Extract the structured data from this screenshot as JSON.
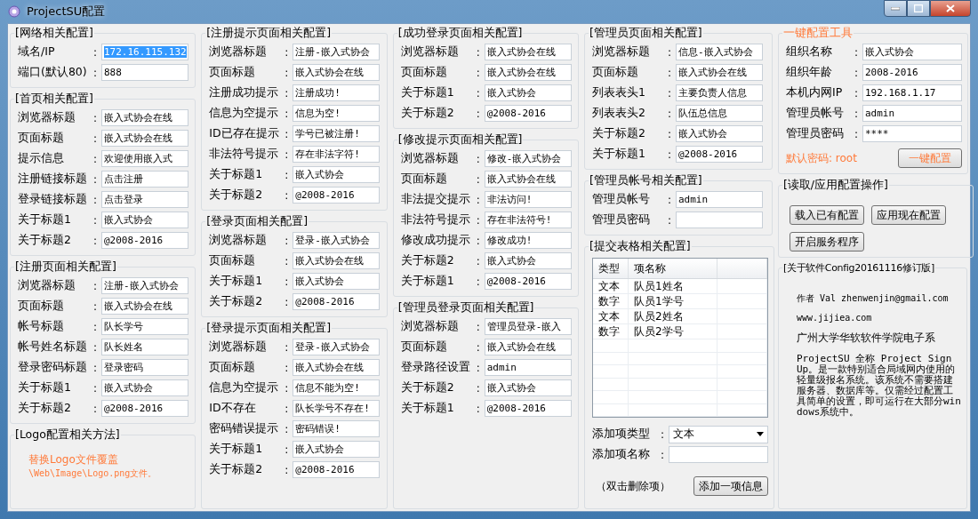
{
  "window": {
    "title": "ProjectSU配置"
  },
  "columns": [
    {
      "groups": [
        {
          "kind": "form",
          "title": "[网络相关配置]",
          "rows": [
            {
              "label": "域名/IP",
              "colon": ":",
              "value": "172.16.115.132",
              "selected": true
            },
            {
              "label": "端口(默认80)",
              "colon": ":",
              "value": "888",
              "selected": false
            }
          ]
        },
        {
          "kind": "form",
          "title": "[首页相关配置]",
          "rows": [
            {
              "label": "浏览器标题",
              "colon": ":",
              "value": "嵌入式协会在线"
            },
            {
              "label": "页面标题",
              "colon": ":",
              "value": "嵌入式协会在线"
            },
            {
              "label": "提示信息",
              "colon": ":",
              "value": "欢迎使用嵌入式"
            },
            {
              "label": "注册链接标题",
              "colon": ":",
              "value": "点击注册"
            },
            {
              "label": "登录链接标题",
              "colon": ":",
              "value": "点击登录"
            },
            {
              "label": "关于标题1",
              "colon": ":",
              "value": "嵌入式协会"
            },
            {
              "label": "关于标题2",
              "colon": ":",
              "value": "@2008-2016"
            }
          ]
        },
        {
          "kind": "form",
          "title": "[注册页面相关配置]",
          "rows": [
            {
              "label": "浏览器标题",
              "colon": ":",
              "value": "注册-嵌入式协会"
            },
            {
              "label": "页面标题",
              "colon": ":",
              "value": "嵌入式协会在线"
            },
            {
              "label": "帐号标题",
              "colon": ":",
              "value": "队长学号"
            },
            {
              "label": "帐号姓名标题",
              "colon": ":",
              "value": "队长姓名"
            },
            {
              "label": "登录密码标题",
              "colon": ":",
              "value": "登录密码"
            },
            {
              "label": "关于标题1",
              "colon": ":",
              "value": "嵌入式协会"
            },
            {
              "label": "关于标题2",
              "colon": ":",
              "value": "@2008-2016"
            }
          ]
        },
        {
          "kind": "note",
          "title": "[Logo配置相关方法]",
          "lines": [
            "替换Logo文件覆盖",
            "\\Web\\Image\\Logo.png文件。"
          ]
        }
      ]
    },
    {
      "groups": [
        {
          "kind": "form",
          "title": "[注册提示页面相关配置]",
          "rows": [
            {
              "label": "浏览器标题",
              "colon": ":",
              "value": "注册-嵌入式协会"
            },
            {
              "label": "页面标题",
              "colon": ":",
              "value": "嵌入式协会在线"
            },
            {
              "label": "注册成功提示",
              "colon": ":",
              "value": "注册成功!"
            },
            {
              "label": "信息为空提示",
              "colon": ":",
              "value": "信息为空!"
            },
            {
              "label": "ID已存在提示",
              "colon": ":",
              "value": "学号已被注册!"
            },
            {
              "label": "非法符号提示",
              "colon": ":",
              "value": "存在非法字符!"
            },
            {
              "label": "关于标题1",
              "colon": ":",
              "value": "嵌入式协会"
            },
            {
              "label": "关于标题2",
              "colon": ":",
              "value": "@2008-2016"
            }
          ]
        },
        {
          "kind": "form",
          "title": "[登录页面相关配置]",
          "rows": [
            {
              "label": "浏览器标题",
              "colon": ":",
              "value": "登录-嵌入式协会"
            },
            {
              "label": "页面标题",
              "colon": ":",
              "value": "嵌入式协会在线"
            },
            {
              "label": "关于标题1",
              "colon": ":",
              "value": "嵌入式协会"
            },
            {
              "label": "关于标题2",
              "colon": ":",
              "value": "@2008-2016"
            }
          ]
        },
        {
          "kind": "form",
          "title": "[登录提示页面相关配置]",
          "rows": [
            {
              "label": "浏览器标题",
              "colon": ":",
              "value": "登录-嵌入式协会"
            },
            {
              "label": "页面标题",
              "colon": ":",
              "value": "嵌入式协会在线"
            },
            {
              "label": "信息为空提示",
              "colon": ":",
              "value": "信息不能为空!"
            },
            {
              "label": "ID不存在",
              "colon": ":",
              "value": "队长学号不存在!"
            },
            {
              "label": "密码错误提示",
              "colon": ":",
              "value": "密码错误!"
            },
            {
              "label": "关于标题1",
              "colon": ":",
              "value": "嵌入式协会"
            },
            {
              "label": "关于标题2",
              "colon": ":",
              "value": "@2008-2016"
            }
          ]
        }
      ]
    },
    {
      "groups": [
        {
          "kind": "form",
          "title": "[成功登录页面相关配置]",
          "rows": [
            {
              "label": "浏览器标题",
              "colon": ":",
              "value": "嵌入式协会在线"
            },
            {
              "label": "页面标题",
              "colon": ":",
              "value": "嵌入式协会在线"
            },
            {
              "label": "关于标题1",
              "colon": ":",
              "value": "嵌入式协会"
            },
            {
              "label": "关于标题2",
              "colon": ":",
              "value": "@2008-2016"
            }
          ]
        },
        {
          "kind": "form",
          "title": "[修改提示页面相关配置]",
          "rows": [
            {
              "label": "浏览器标题",
              "colon": ":",
              "value": "修改-嵌入式协会"
            },
            {
              "label": "页面标题",
              "colon": ":",
              "value": "嵌入式协会在线"
            },
            {
              "label": "非法提交提示",
              "colon": ":",
              "value": "非法访问!"
            },
            {
              "label": "非法符号提示",
              "colon": ":",
              "value": "存在非法符号!"
            },
            {
              "label": "修改成功提示",
              "colon": ":",
              "value": "修改成功!"
            },
            {
              "label": "关于标题2",
              "colon": ":",
              "value": "嵌入式协会"
            },
            {
              "label": "关于标题1",
              "colon": ":",
              "value": "@2008-2016"
            }
          ]
        },
        {
          "kind": "form",
          "title": "[管理员登录页面相关配置]",
          "rows": [
            {
              "label": "浏览器标题",
              "colon": ":",
              "value": "管理员登录-嵌入"
            },
            {
              "label": "页面标题",
              "colon": ":",
              "value": "嵌入式协会在线"
            },
            {
              "label": "登录路径设置",
              "colon": ":",
              "value": "admin"
            },
            {
              "label": "关于标题2",
              "colon": ":",
              "value": "嵌入式协会"
            },
            {
              "label": "关于标题1",
              "colon": ":",
              "value": "@2008-2016"
            }
          ]
        }
      ]
    },
    {
      "groups": [
        {
          "kind": "form",
          "title": "[管理员页面相关配置]",
          "rows": [
            {
              "label": "浏览器标题",
              "colon": ":",
              "value": "信息-嵌入式协会"
            },
            {
              "label": "页面标题",
              "colon": ":",
              "value": "嵌入式协会在线"
            },
            {
              "label": "列表表头1",
              "colon": ":",
              "value": "主要负责人信息"
            },
            {
              "label": "列表表头2",
              "colon": ":",
              "value": "队伍总信息"
            },
            {
              "label": "关于标题2",
              "colon": ":",
              "value": "嵌入式协会"
            },
            {
              "label": "关于标题1",
              "colon": ":",
              "value": "@2008-2016"
            }
          ]
        },
        {
          "kind": "form",
          "title": "[管理员帐号相关配置]",
          "rows": [
            {
              "label": "管理员帐号",
              "colon": ":",
              "value": "admin"
            },
            {
              "label": "管理员密码",
              "colon": ":"
            }
          ]
        },
        {
          "kind": "table",
          "title": "[提交表格相关配置]",
          "table": {
            "columns": [
              "类型",
              "项名称"
            ],
            "rows": [
              [
                "文本",
                "队员1姓名"
              ],
              [
                "数字",
                "队员1学号"
              ],
              [
                "文本",
                "队员2姓名"
              ],
              [
                "数字",
                "队员2学号"
              ]
            ]
          },
          "add_type": {
            "label": "添加项类型",
            "colon": ":",
            "value": "文本"
          },
          "add_name": {
            "label": "添加项名称",
            "colon": ":"
          },
          "hint": "（双击删除项）",
          "button": "添加一项信息"
        }
      ]
    },
    {
      "groups": [
        {
          "kind": "quick",
          "title": "一键配置工具",
          "rows": [
            {
              "label": "组织名称",
              "colon": ":",
              "value": "嵌入式协会"
            },
            {
              "label": "组织年龄",
              "colon": ":",
              "value": "2008-2016"
            },
            {
              "label": "本机内网IP",
              "colon": ":",
              "value": "192.168.1.17"
            },
            {
              "label": "管理员帐号",
              "colon": ":",
              "value": "admin"
            },
            {
              "label": "管理员密码",
              "colon": ":",
              "value": "****"
            }
          ],
          "default_note": "默认密码: root",
          "button": "一键配置"
        },
        {
          "kind": "buttons",
          "title": "[读取/应用配置操作]",
          "buttons": [
            "载入已有配置",
            "应用现在配置",
            "开启服务程序"
          ]
        },
        {
          "kind": "about",
          "title": "[关于软件Config20161116修订版]",
          "lines": [
            "作者 Val zhenwenjin@gmail.com",
            "www.jijiea.com",
            "广州大学华软软件学院电子系"
          ],
          "paragraph": "ProjectSU 全称 Project Sign Up。是一款特别适合局域网内使用的轻量级报名系统。该系统不需要搭建服务器、数据库等。仅需经过配置工具简单的设置，即可运行在大部分windows系统中。"
        }
      ]
    }
  ]
}
